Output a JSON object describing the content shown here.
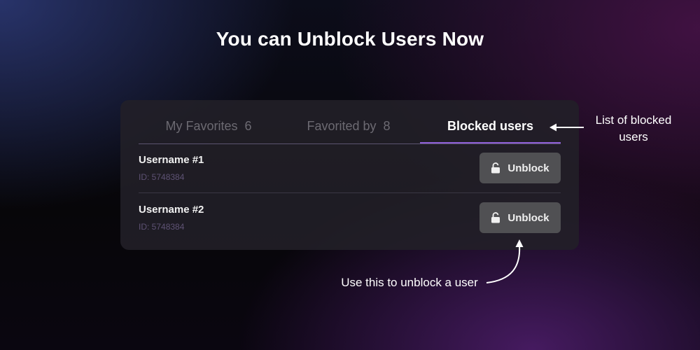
{
  "title": "You can Unblock Users Now",
  "tabs": [
    {
      "label": "My Favorites",
      "count": "6"
    },
    {
      "label": "Favorited by",
      "count": "8"
    },
    {
      "label": "Blocked users",
      "count": null
    }
  ],
  "active_tab": "Blocked users",
  "blocked_users": [
    {
      "username": "Username #1",
      "id": "ID: 5748384",
      "action": "Unblock",
      "action_icon": "unlock-icon"
    },
    {
      "username": "Username #2",
      "id": "ID: 5748384",
      "action": "Unblock",
      "action_icon": "unlock-icon"
    }
  ],
  "annotations": {
    "list_note": "List of blocked users",
    "button_note": "Use this to unblock a user"
  },
  "colors": {
    "accent": "#8e5fd6",
    "button_bg": "#505053",
    "card_bg": "#222028",
    "id_text": "#5e5274"
  }
}
